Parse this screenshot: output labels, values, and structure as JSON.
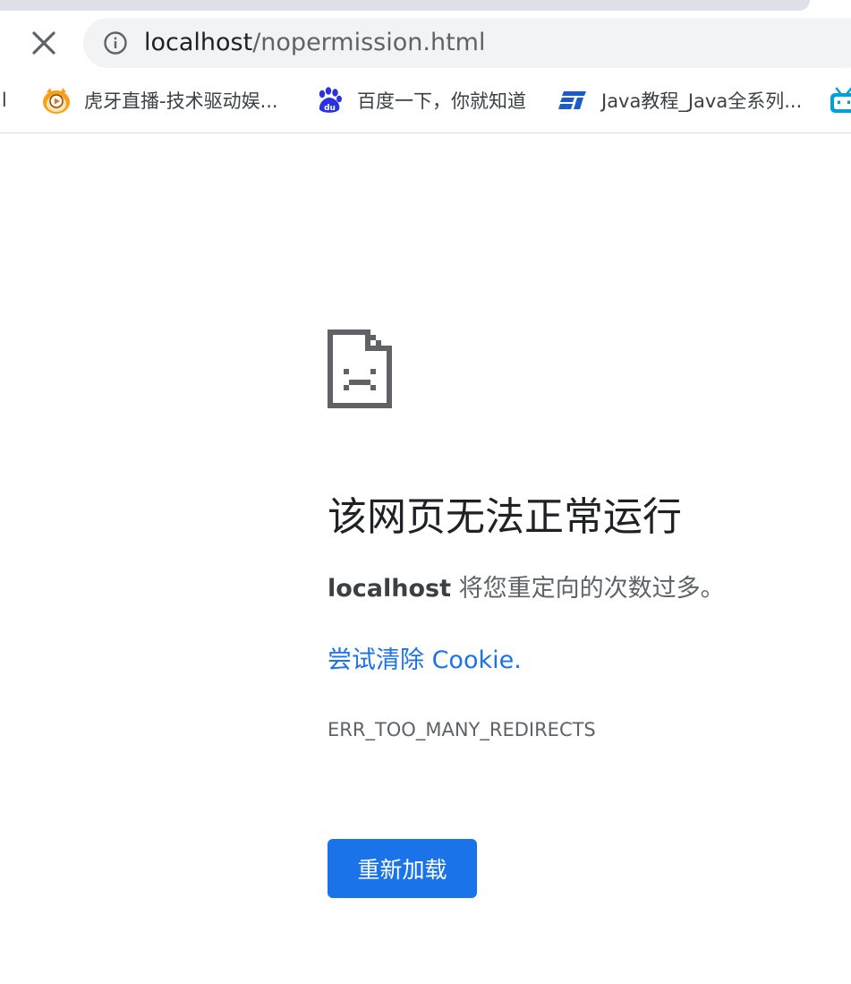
{
  "browser": {
    "url_host": "localhost",
    "url_path": "/nopermission.html",
    "bookmarks": [
      {
        "label": "il",
        "icon": "mail-icon"
      },
      {
        "label": "虎牙直播-技术驱动娱...",
        "icon": "huya-icon"
      },
      {
        "label": "百度一下，你就知道",
        "icon": "baidu-icon"
      },
      {
        "label": "Java教程_Java全系列...",
        "icon": "java-tutorial-icon"
      },
      {
        "label": "",
        "icon": "bilibili-icon"
      }
    ]
  },
  "error_page": {
    "title": "该网页无法正常运行",
    "message_host": "localhost",
    "message_rest": " 将您重定向的次数过多。",
    "suggestion_link": "尝试清除 Cookie.",
    "error_code": "ERR_TOO_MANY_REDIRECTS",
    "reload_label": "重新加载"
  },
  "colors": {
    "accent": "#1a73e8",
    "icon_gray": "#5f6368"
  }
}
